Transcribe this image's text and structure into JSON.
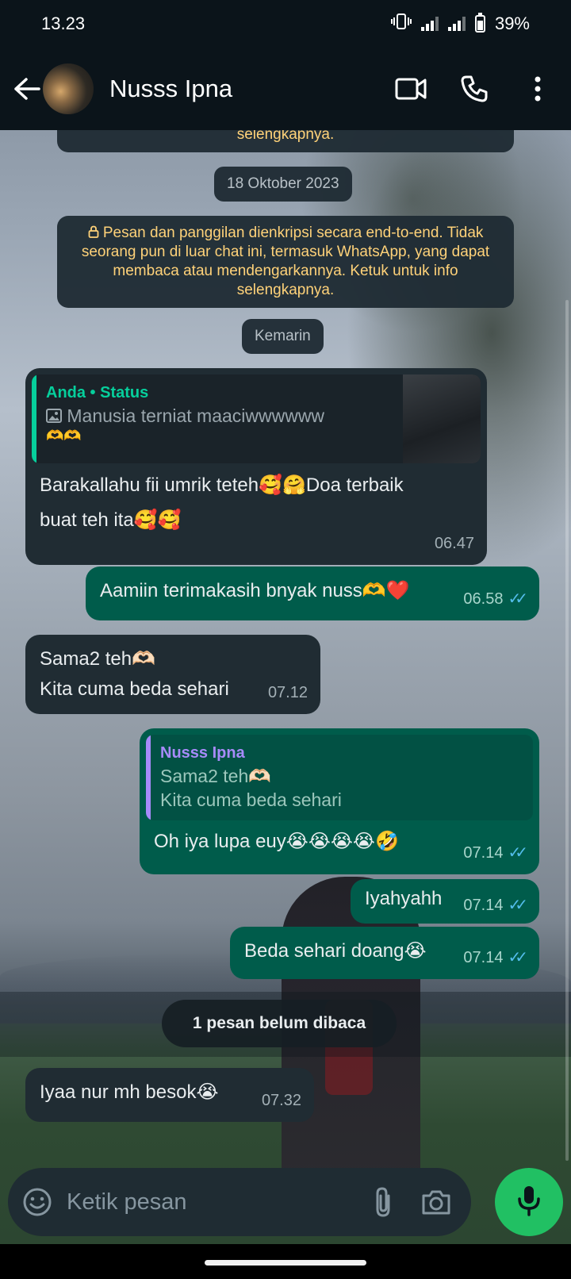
{
  "status_bar": {
    "time": "13.23",
    "battery": "39%"
  },
  "header": {
    "contact_name": "Nusss Ipna"
  },
  "notices": {
    "top_partial": "selengkapnya.",
    "encryption": "Pesan dan panggilan dienkripsi secara end-to-end. Tidak seorang pun di luar chat ini, termasuk WhatsApp, yang dapat membaca atau mendengarkannya. Ketuk untuk info selengkapnya."
  },
  "date_chips": {
    "first": "18 Oktober 2023",
    "second": "Kemarin"
  },
  "messages": [
    {
      "direction": "in",
      "quote_author": "Anda • Status",
      "quote_text": "Manusia terniat maaciwwwwww",
      "quote_emoji": "🫶🫶",
      "text_line1": "Barakallahu fii umrik teteh🥰🤗Doa terbaik",
      "text_line2": "buat teh ita🥰🥰",
      "time": "06.47"
    },
    {
      "direction": "out",
      "text": "Aamiin terimakasih bnyak nuss🫶❤️",
      "time": "06.58"
    },
    {
      "direction": "in",
      "text_line1": "Sama2 teh🫶🏻",
      "text_line2": "Kita cuma beda sehari",
      "time": "07.12"
    },
    {
      "direction": "out",
      "quote_author": "Nusss Ipna",
      "quote_line1": "Sama2 teh🫶🏻",
      "quote_line2": "Kita cuma beda sehari",
      "text": "Oh iya lupa euy😭😭😭😭🤣",
      "time": "07.14"
    },
    {
      "direction": "out",
      "text": "Iyahyahh",
      "time": "07.14"
    },
    {
      "direction": "out",
      "text": "Beda sehari doang😭",
      "time": "07.14"
    },
    {
      "direction": "in",
      "text": "Iyaa nur mh besok😭",
      "time": "07.32"
    }
  ],
  "unread_label": "1 pesan belum dibaca",
  "composer": {
    "placeholder": "Ketik pesan"
  },
  "colors": {
    "incoming": "#202c33",
    "outgoing": "#005c4b",
    "accent": "#21c063",
    "ticks": "#53bdeb"
  }
}
